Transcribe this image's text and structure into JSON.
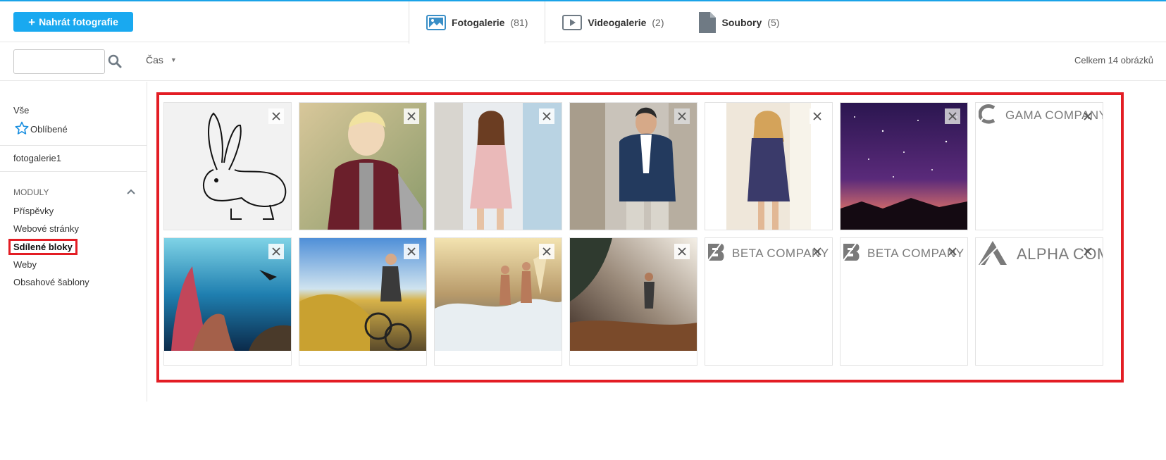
{
  "header": {
    "upload_label": "Nahrát fotografie",
    "tabs": [
      {
        "label": "Fotogalerie",
        "count": "(81)",
        "icon": "image-icon",
        "active": true
      },
      {
        "label": "Videogalerie",
        "count": "(2)",
        "icon": "video-icon",
        "active": false
      },
      {
        "label": "Soubory",
        "count": "(5)",
        "icon": "file-icon",
        "active": false
      }
    ]
  },
  "toolbar": {
    "search_value": "",
    "sort_label": "Čas",
    "total_label": "Celkem 14 obrázků"
  },
  "sidebar": {
    "all_label": "Vše",
    "favorites_label": "Oblíbené",
    "gallery_label": "fotogalerie1",
    "modules_heading": "MODULY",
    "modules": [
      {
        "label": "Příspěvky",
        "active": false
      },
      {
        "label": "Webové stránky",
        "active": false
      },
      {
        "label": "Sdílené bloky",
        "active": true
      },
      {
        "label": "Weby",
        "active": false
      },
      {
        "label": "Obsahové šablony",
        "active": false
      }
    ]
  },
  "gallery": {
    "thumbnails": [
      {
        "kind": "photo",
        "name": "rabbit-sketch"
      },
      {
        "kind": "photo",
        "name": "boy-in-vest"
      },
      {
        "kind": "photo",
        "name": "girl-pink-dress"
      },
      {
        "kind": "photo",
        "name": "man-in-suit"
      },
      {
        "kind": "photo",
        "name": "woman-dotted-dress"
      },
      {
        "kind": "photo",
        "name": "starry-night-sky"
      },
      {
        "kind": "logo",
        "name": "gama-logo",
        "text": "GAMA COMPANY"
      },
      {
        "kind": "photo",
        "name": "coral-reef-diver"
      },
      {
        "kind": "photo",
        "name": "mountain-biker"
      },
      {
        "kind": "photo",
        "name": "surfers-beach"
      },
      {
        "kind": "photo",
        "name": "trail-runner"
      },
      {
        "kind": "logo",
        "name": "beta-logo",
        "text": "BETA COMPANY"
      },
      {
        "kind": "logo",
        "name": "beta-logo",
        "text": "BETA COMPANY"
      },
      {
        "kind": "logo",
        "name": "alpha-logo",
        "text": "ALPHA COMPANY"
      }
    ]
  },
  "colors": {
    "accent": "#19a9f0",
    "highlight": "#e31d24",
    "icon_gray": "#6f7a84"
  }
}
